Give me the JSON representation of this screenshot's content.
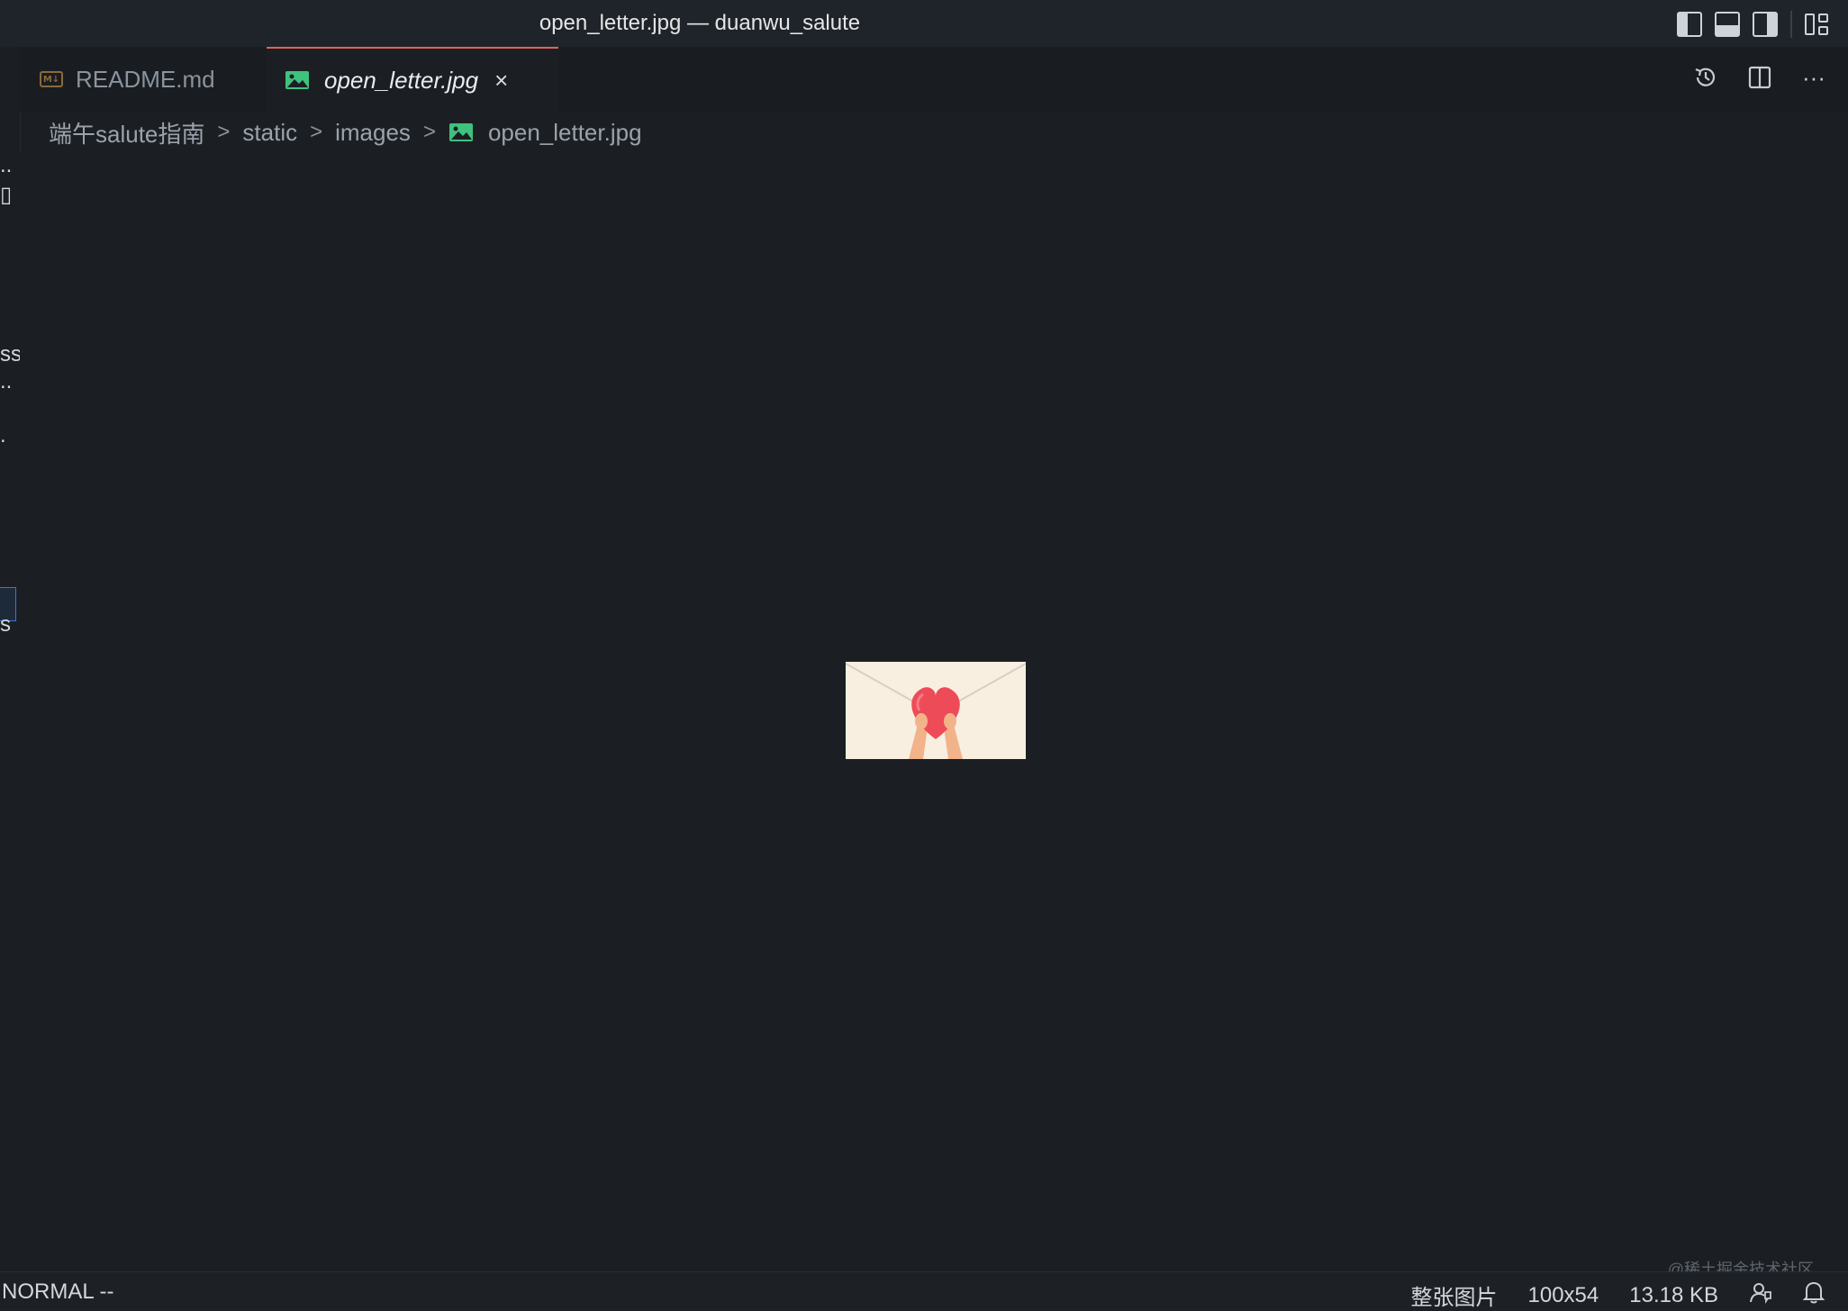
{
  "window": {
    "title": "open_letter.jpg — duanwu_salute"
  },
  "layout_controls": [
    {
      "icon": "toggle-primary-sidebar-icon"
    },
    {
      "icon": "toggle-panel-icon"
    },
    {
      "icon": "toggle-secondary-sidebar-icon"
    },
    {
      "icon": "customize-layout-icon"
    }
  ],
  "tabs": [
    {
      "label": "README.md",
      "icon": "markdown-file-icon",
      "md_badge": "M↓",
      "active": false
    },
    {
      "label": "open_letter.jpg",
      "icon": "image-file-icon",
      "active": true,
      "close": "×"
    }
  ],
  "tab_actions": [
    {
      "icon": "timeline-history-icon"
    },
    {
      "icon": "split-editor-icon"
    },
    {
      "icon": "more-actions-icon",
      "glyph": "···"
    }
  ],
  "breadcrumb": {
    "items": [
      "端午salute指南",
      "static",
      "images",
      "open_letter.jpg"
    ],
    "separator": ">"
  },
  "sidebar_fragments": [
    "..",
    "ss",
    "..",
    ".",
    "s"
  ],
  "statusbar": {
    "mode": "NORMAL --",
    "zoom_label": "整张图片",
    "dimensions": "100x54",
    "file_size": "13.18 KB"
  },
  "watermark": "@稀土掘金技术社区",
  "colors": {
    "active_tab_border": "#e0625c",
    "image_icon": "#3fc27d",
    "background": "#1b1f24"
  }
}
